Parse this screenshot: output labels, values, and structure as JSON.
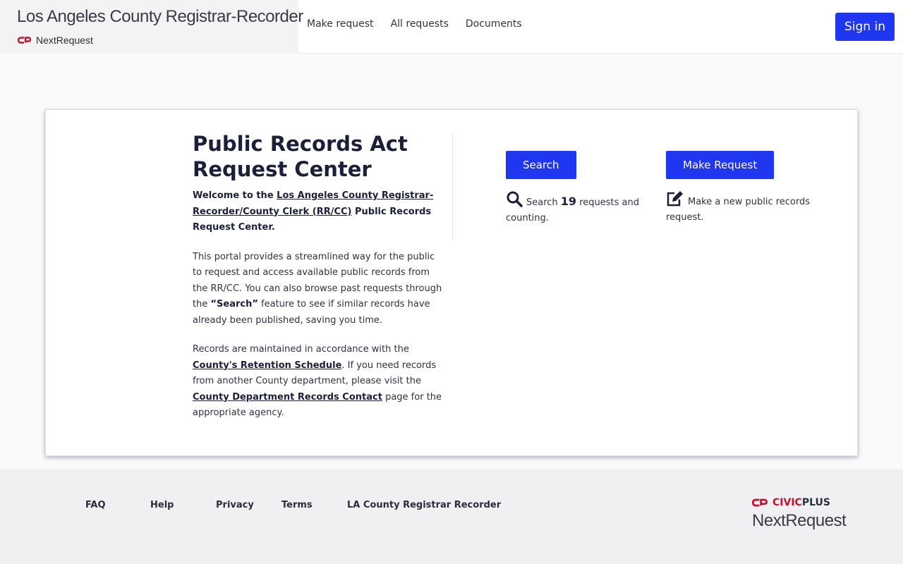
{
  "header": {
    "title": "Los Angeles County Registrar-Recorder",
    "subbrand": "NextRequest",
    "nav": [
      "Make request",
      "All requests",
      "Documents"
    ],
    "sign_in": "Sign in"
  },
  "intro": {
    "heading": "Public Records Act Request Center",
    "welcome_pre": "Welcome to the ",
    "welcome_link": "Los Angeles County Registrar-Recorder/County Clerk (RR/CC)",
    "welcome_post": " Public Records Request Center.",
    "p1_pre": "This portal provides a streamlined way for the public to request and access available public records from the RR/CC. You can also browse past requests through the ",
    "p1_bold": "“Search”",
    "p1_post": " feature to see if similar records have already been published, saving you time.",
    "p2_pre": "Records are maintained in accordance with the ",
    "p2_link1": "County's Retention Schedule",
    "p2_mid": ". If you need records from another County department, please visit the ",
    "p2_link2": "County Department Records Contact",
    "p2_post": " page for the appropriate agency."
  },
  "search": {
    "button": "Search",
    "desc_pre": "Search ",
    "count": "19",
    "desc_post": " requests and counting."
  },
  "make_request": {
    "button": "Make Request",
    "desc": "Make a new public records request."
  },
  "footer": {
    "links": [
      "FAQ",
      "Help",
      "Privacy",
      "Terms",
      "LA County Registrar Recorder"
    ],
    "civic": "CIVIC",
    "plus": "PLUS",
    "product": "NextRequest"
  },
  "colors": {
    "primary": "#1f37f0",
    "brand_red": "#c8102e",
    "text": "#1d1f3a"
  }
}
